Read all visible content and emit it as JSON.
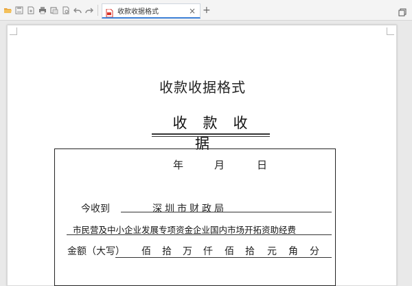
{
  "toolbar": {
    "icons": [
      "open-folder-icon",
      "save-icon",
      "export-icon",
      "print-icon",
      "print-preview-icon",
      "preview-icon",
      "undo-icon",
      "redo-icon",
      "dropdown-icon"
    ]
  },
  "tab": {
    "title": "收款收据格式",
    "close_glyph": "×",
    "new_tab_glyph": "+"
  },
  "document": {
    "heading": "收款收据格式",
    "receipt_title": "收款收据",
    "date": {
      "year": "年",
      "month": "月",
      "day": "日"
    },
    "received_label": "今收到",
    "payer": "深圳市财政局",
    "purpose": "市民营及中小企业发展专项资金企业国内市场开拓资助经费",
    "amount_label": "金额（大写）",
    "amount_units": [
      "佰",
      "拾",
      "万",
      "仟",
      "佰",
      "拾",
      "元",
      "角",
      "分"
    ]
  },
  "colors": {
    "accent": "#3b7fd6",
    "pdf_icon": "#d9342b"
  }
}
